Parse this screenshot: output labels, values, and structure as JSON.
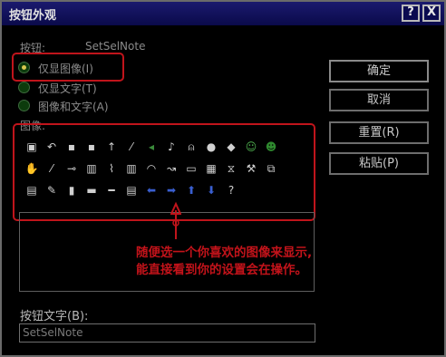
{
  "window": {
    "title": "按钮外观",
    "help_label": "?",
    "close_label": "X"
  },
  "preview": {
    "label": "按钮:",
    "value": "SetSelNote"
  },
  "display_options": [
    {
      "label": "仅显图像(I)",
      "selected": true
    },
    {
      "label": "仅显文字(T)",
      "selected": false
    },
    {
      "label": "图像和文字(A)",
      "selected": false
    }
  ],
  "image_group_label": "图像:",
  "icons": [
    [
      "save-icon",
      "undo-icon",
      "floppy-icon",
      "floppy2-icon",
      "pointer-icon",
      "pen-icon",
      "speaker-icon",
      "music-note-icon",
      "bell-icon",
      "chat-bubble-icon",
      "diamond-icon",
      "smiley-icon",
      "face-icon"
    ],
    [
      "hand-icon",
      "pencil-icon",
      "key-icon",
      "book-icon",
      "wrench-icon",
      "trash-icon",
      "car-icon",
      "arrow-bend-icon",
      "box-icon",
      "calendar-icon",
      "hourglass-icon",
      "tools-icon",
      "copy-icon"
    ],
    [
      "printer-icon",
      "brush-icon",
      "pin-icon",
      "keyboard-icon",
      "ruler-icon",
      "note-icon",
      "arrow-left-icon",
      "arrow-right-icon",
      "arrow-up-icon",
      "arrow-down-icon",
      "question-icon"
    ]
  ],
  "icon_glyphs": [
    [
      "▣",
      "↶",
      "▪",
      "▪",
      "↑",
      "⁄",
      "◂",
      "♪",
      "⍝",
      "●",
      "◆",
      "☺",
      "☻"
    ],
    [
      "✋",
      "⁄",
      "⊸",
      "▥",
      "⌇",
      "▥",
      "◠",
      "↝",
      "▭",
      "▦",
      "⧖",
      "⚒",
      "⧉"
    ],
    [
      "▤",
      "✎",
      "▮",
      "▬",
      "━",
      "▤",
      "⬅",
      "➡",
      "⬆",
      "⬇",
      "?"
    ]
  ],
  "buttons": {
    "ok": "确定",
    "cancel": "取消",
    "reset": "重置(R)",
    "paste": "粘贴(P)"
  },
  "callout_lines": [
    "随便选一个你喜欢的图像来显示,",
    "能直接看到你的设置会在操作。"
  ],
  "button_text_label": "按钮文字(B):",
  "button_text_value": "SetSelNote",
  "colors": {
    "highlight": "#c0141b",
    "titlebar": "#1b1a6e"
  }
}
